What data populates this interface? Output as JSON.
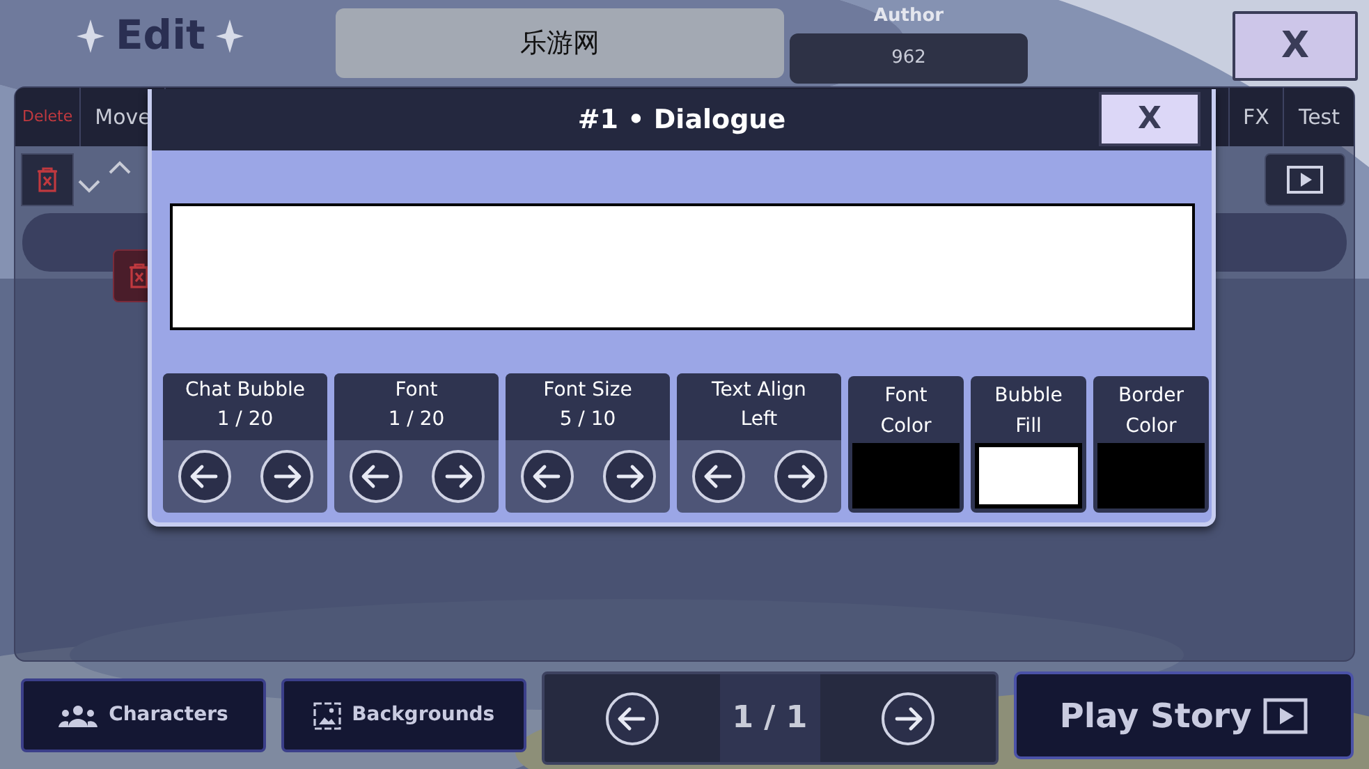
{
  "header": {
    "title": "Edit",
    "story_title": "乐游网",
    "author_label": "Author",
    "author": "962",
    "close": "X"
  },
  "toolbar": {
    "left": [
      {
        "label": "Delete",
        "kind": "danger"
      },
      {
        "label": "Move",
        "kind": "plain"
      }
    ],
    "right": [
      "FX",
      "Test"
    ]
  },
  "dialog": {
    "title": "#1 • Dialogue",
    "close": "X"
  },
  "controls": [
    {
      "kind": "stepper",
      "label": "Chat Bubble",
      "value": "1 / 20"
    },
    {
      "kind": "stepper",
      "label": "Font",
      "value": "1 / 20"
    },
    {
      "kind": "stepper",
      "label": "Font Size",
      "value": "5 / 10"
    },
    {
      "kind": "stepper",
      "label": "Text Align",
      "value": "Left"
    },
    {
      "kind": "swatch",
      "label": "Font Color",
      "color": "#000000"
    },
    {
      "kind": "swatch",
      "label": "Bubble Fill",
      "color": "#ffffff"
    },
    {
      "kind": "swatch",
      "label": "Border Color",
      "color": "#000000"
    }
  ],
  "bottom": {
    "characters": "Characters",
    "backgrounds": "Backgrounds",
    "page": "1 / 1",
    "play": "Play Story"
  }
}
